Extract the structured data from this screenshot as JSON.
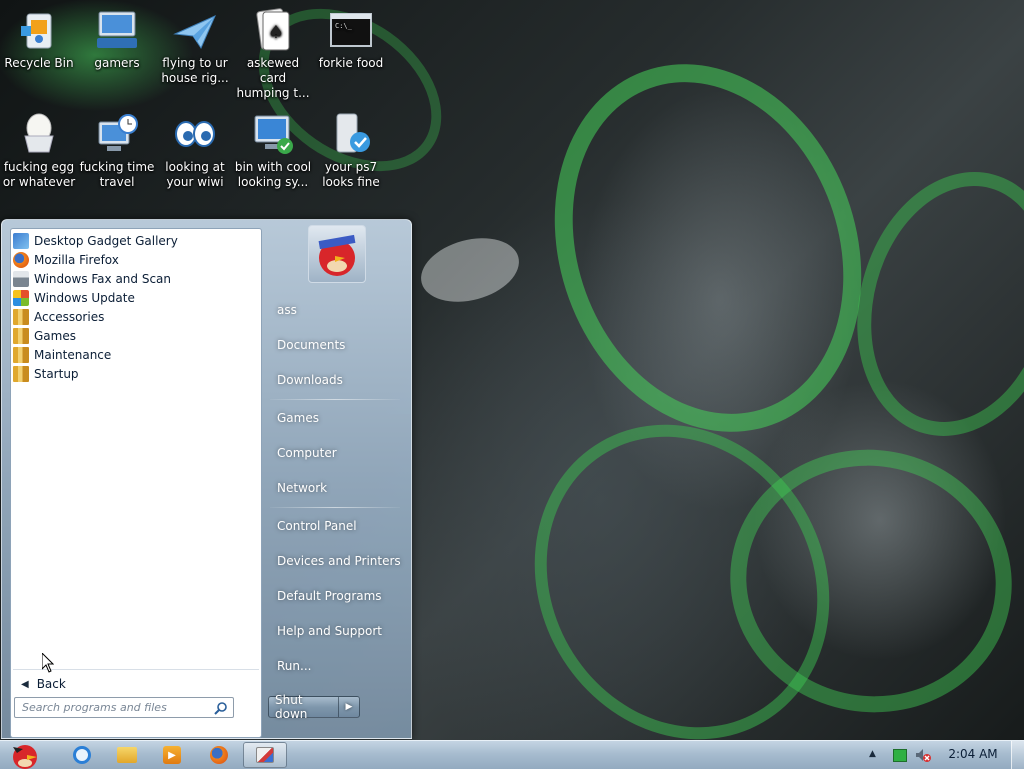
{
  "desktop": {
    "icons": [
      {
        "label": "Recycle Bin",
        "icon": "recycle-bin-icon"
      },
      {
        "label": "gamers",
        "icon": "keyboard-computer-icon"
      },
      {
        "label": "flying to ur house rig...",
        "icon": "paper-plane-icon"
      },
      {
        "label": "askewed card humping t...",
        "icon": "playing-cards-icon"
      },
      {
        "label": "forkie food",
        "icon": "command-prompt-icon"
      },
      {
        "label": "fucking egg or whatever",
        "icon": "egg-cup-icon"
      },
      {
        "label": "fucking time travel",
        "icon": "computer-clock-icon"
      },
      {
        "label": "looking at your wiwi",
        "icon": "eyes-icon"
      },
      {
        "label": "bin with cool looking sy...",
        "icon": "network-computer-icon"
      },
      {
        "label": "your ps7 looks fine",
        "icon": "checkmark-drive-icon"
      }
    ]
  },
  "start_menu": {
    "programs": [
      {
        "label": "Desktop Gadget Gallery",
        "icon": "gadget-icon"
      },
      {
        "label": "Mozilla Firefox",
        "icon": "firefox-icon"
      },
      {
        "label": "Windows Fax and Scan",
        "icon": "fax-icon"
      },
      {
        "label": "Windows Update",
        "icon": "windows-update-icon"
      },
      {
        "label": "Accessories",
        "icon": "folder-icon"
      },
      {
        "label": "Games",
        "icon": "folder-icon"
      },
      {
        "label": "Maintenance",
        "icon": "folder-icon"
      },
      {
        "label": "Startup",
        "icon": "folder-icon"
      }
    ],
    "back_label": "Back",
    "search_placeholder": "Search programs and files",
    "right_items": [
      {
        "label": "ass"
      },
      {
        "label": "Documents"
      },
      {
        "label": "Downloads"
      },
      {
        "label": "Games"
      },
      {
        "label": "Computer"
      },
      {
        "label": "Network"
      },
      {
        "label": "Control Panel"
      },
      {
        "label": "Devices and Printers"
      },
      {
        "label": "Default Programs"
      },
      {
        "label": "Help and Support"
      },
      {
        "label": "Run..."
      }
    ],
    "shutdown_label": "Shut down"
  },
  "taskbar": {
    "items": [
      {
        "icon": "angry-bird-start-icon"
      },
      {
        "icon": "internet-explorer-icon"
      },
      {
        "icon": "folder-libraries-icon"
      },
      {
        "icon": "media-player-icon"
      },
      {
        "icon": "firefox-icon"
      },
      {
        "icon": "paint-icon"
      }
    ],
    "clock": "2:04 AM"
  }
}
